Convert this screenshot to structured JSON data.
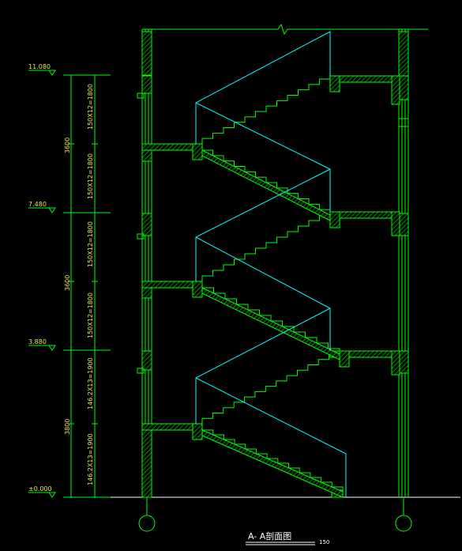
{
  "drawing": {
    "title": "A- A剖面图",
    "scale_note": "150",
    "colors": {
      "background": "#000000",
      "wall": "#00ff00",
      "hatch": "#00c800",
      "stair_outline": "#00ffff",
      "grid_line": "#ffffff",
      "text": "#ffffff",
      "text_dim": "#e8e84a"
    }
  },
  "elevations": [
    {
      "id": "top",
      "label": "11.080"
    },
    {
      "id": "level3",
      "label": "7.480"
    },
    {
      "id": "level2",
      "label": "3.880"
    },
    {
      "id": "ground",
      "label": "±0.000"
    }
  ],
  "floor_heights": [
    {
      "id": "f3",
      "label": "3600"
    },
    {
      "id": "f2",
      "label": "3600"
    },
    {
      "id": "f1",
      "label": "3800"
    }
  ],
  "flight_dims": [
    {
      "id": "d1",
      "label": "150X12=1800"
    },
    {
      "id": "d2",
      "label": "150X12=1800"
    },
    {
      "id": "d3",
      "label": "150X12=1800"
    },
    {
      "id": "d4",
      "label": "150X12=1800"
    },
    {
      "id": "d5",
      "label": "146.2X13=1900"
    },
    {
      "id": "d6",
      "label": "146.2X13=1900"
    }
  ],
  "axes": [
    {
      "id": "axis-left",
      "label": ""
    },
    {
      "id": "axis-right",
      "label": ""
    }
  ]
}
